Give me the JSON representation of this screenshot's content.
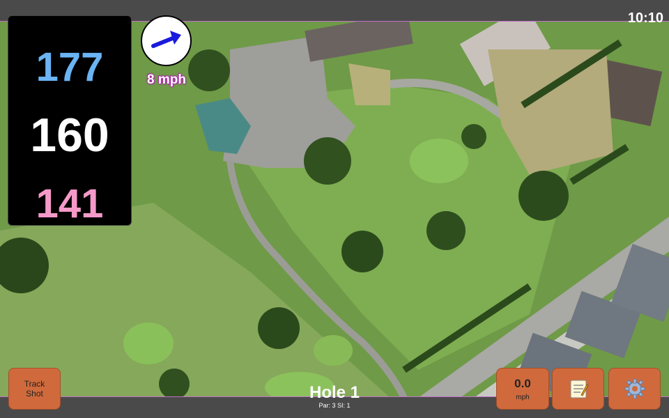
{
  "status": {
    "clock": "10:10"
  },
  "yardage": {
    "back": "177",
    "middle": "160",
    "front": "141"
  },
  "wind": {
    "speed_label": "8 mph",
    "icon": "wind-arrow-icon",
    "arrow_color": "#1a1adc"
  },
  "hole": {
    "title": "Hole 1",
    "subtitle": "Par: 3   SI: 1"
  },
  "buttons": {
    "track_shot": "Track\nShot",
    "speed_value": "0.0",
    "speed_unit": "mph",
    "notes_icon": "notepad-icon",
    "settings_icon": "gear-icon"
  },
  "colors": {
    "button_bg": "#d06a3c",
    "back_yardage": "#6ab4f4",
    "front_yardage": "#f59ac8",
    "wind_label_glow": "#b020b0"
  }
}
